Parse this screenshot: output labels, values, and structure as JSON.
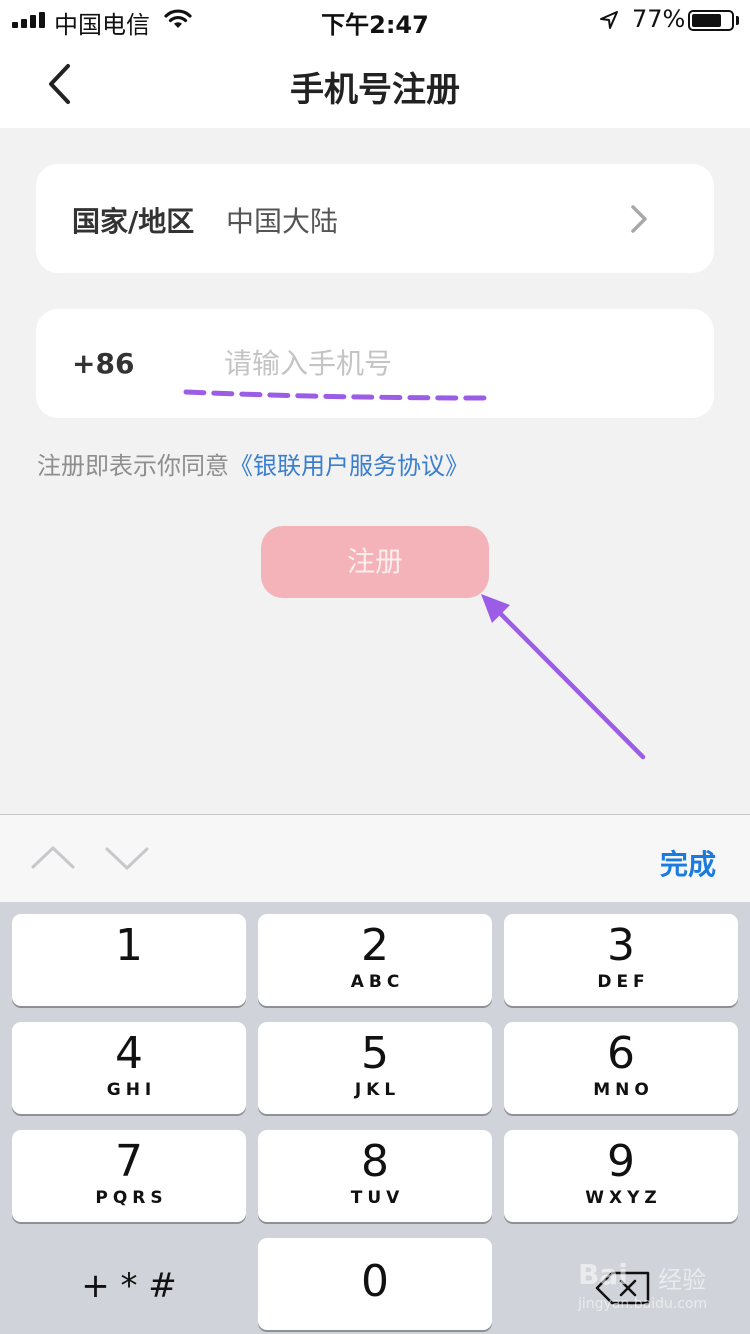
{
  "status_bar": {
    "carrier": "中国电信",
    "time": "下午2:47",
    "battery_percent_text": "77%",
    "battery_level": 0.77,
    "icons": [
      "signal-icon",
      "wifi-icon",
      "location-arrow-icon",
      "battery-icon"
    ]
  },
  "nav": {
    "title": "手机号注册",
    "back_icon": "chevron-left-icon"
  },
  "region": {
    "label": "国家/地区",
    "value": "中国大陆",
    "icon": "chevron-right-icon"
  },
  "phone": {
    "country_code": "+86",
    "value": "",
    "placeholder": "请输入手机号"
  },
  "agreement": {
    "prefix": "注册即表示你同意",
    "link": "《银联用户服务协议》"
  },
  "register_button": {
    "label": "注册"
  },
  "colors": {
    "accent_link": "#3a7fcf",
    "register_button_disabled": "#f3b3b8",
    "annotation": "#9b5de5",
    "done_blue": "#1a7ae0"
  },
  "keyboard": {
    "toolbar": {
      "prev_icon": "chevron-up-icon",
      "next_icon": "chevron-down-icon",
      "done_label": "完成"
    },
    "keys": [
      {
        "num": "1",
        "letters": ""
      },
      {
        "num": "2",
        "letters": "ABC"
      },
      {
        "num": "3",
        "letters": "DEF"
      },
      {
        "num": "4",
        "letters": "GHI"
      },
      {
        "num": "5",
        "letters": "JKL"
      },
      {
        "num": "6",
        "letters": "MNO"
      },
      {
        "num": "7",
        "letters": "PQRS"
      },
      {
        "num": "8",
        "letters": "TUV"
      },
      {
        "num": "9",
        "letters": "WXYZ"
      }
    ],
    "symbols_label": "+ * #",
    "zero": "0",
    "delete_icon": "backspace-icon"
  },
  "watermark": {
    "logo": "Bai",
    "text": "经验",
    "url": "jingyan.baidu.com"
  }
}
